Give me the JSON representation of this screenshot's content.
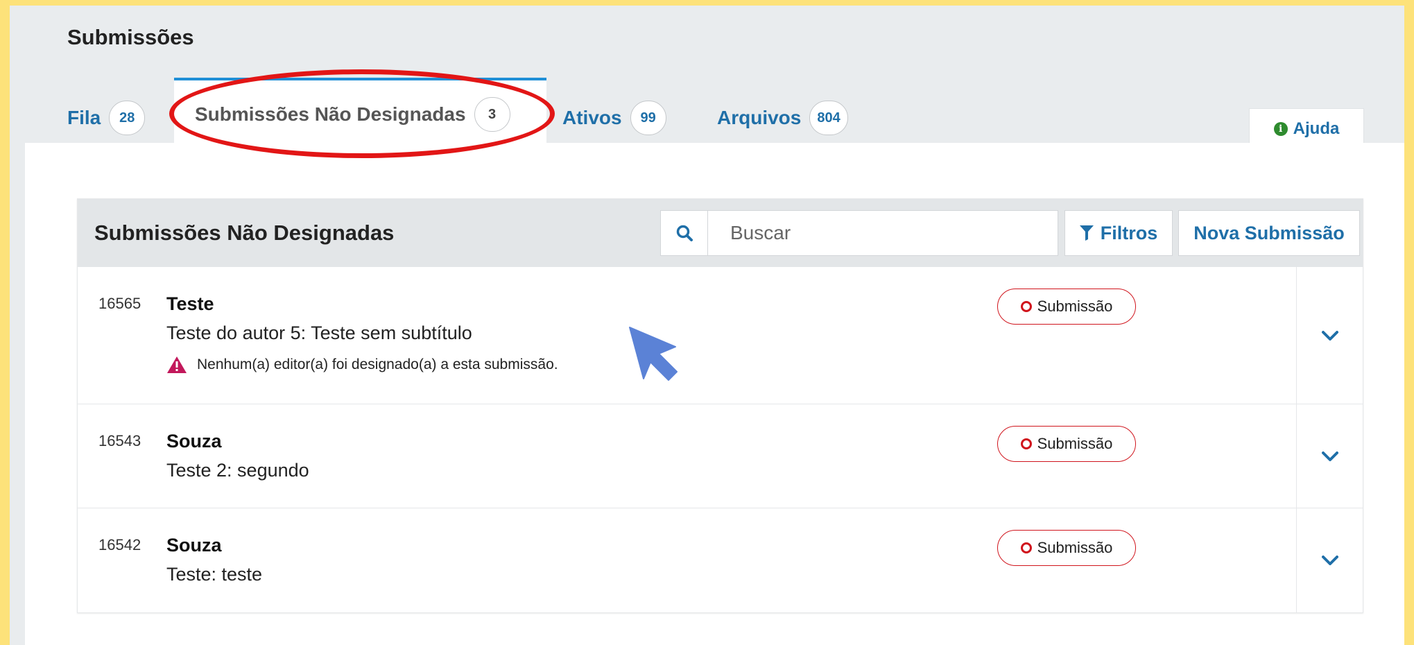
{
  "page": {
    "title": "Submissões"
  },
  "tabs": [
    {
      "label": "Fila",
      "count": "28"
    },
    {
      "label": "Submissões Não Designadas",
      "count": "3"
    },
    {
      "label": "Ativos",
      "count": "99"
    },
    {
      "label": "Arquivos",
      "count": "804"
    }
  ],
  "help": {
    "label": "Ajuda"
  },
  "list": {
    "title": "Submissões Não Designadas",
    "search_placeholder": "Buscar",
    "filter_label": "Filtros",
    "new_label": "Nova Submissão",
    "items": [
      {
        "id": "16565",
        "author": "Teste",
        "title": "Teste do autor 5: Teste sem subtítulo",
        "warning": "Nenhum(a) editor(a) foi designado(a) a esta submissão.",
        "status": "Submissão"
      },
      {
        "id": "16543",
        "author": "Souza",
        "title": "Teste 2: segundo",
        "status": "Submissão"
      },
      {
        "id": "16542",
        "author": "Souza",
        "title": "Teste: teste",
        "status": "Submissão"
      }
    ]
  },
  "colors": {
    "accent": "#1f6fa8",
    "highlight": "#e21616",
    "status": "#d0141c",
    "background": "#fde27a"
  }
}
